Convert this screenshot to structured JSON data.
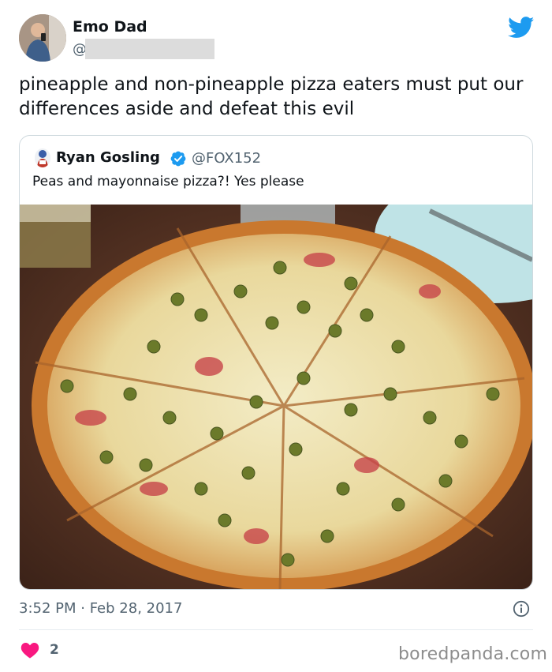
{
  "author": {
    "display_name": "Emo Dad",
    "handle_prefix": "@",
    "avatar_icon": "user-avatar"
  },
  "brand_icon": "twitter-bird-icon",
  "tweet": {
    "text": "pineapple and non-pineapple pizza eaters must put our differences aside and defeat this evil"
  },
  "quoted_tweet": {
    "display_name": "Ryan Gosling",
    "handle": "@FOX152",
    "text": "Peas and mayonnaise pizza?! Yes please",
    "verified": true
  },
  "timestamp": "3:52 PM · Feb 28, 2017",
  "likes": {
    "count": "2",
    "icon": "heart-icon"
  },
  "watermark": "boredpanda.com",
  "colors": {
    "accent": "#1d9bf0",
    "heart": "#f91880",
    "secondary_text": "#536471",
    "border": "#cfd9de"
  }
}
